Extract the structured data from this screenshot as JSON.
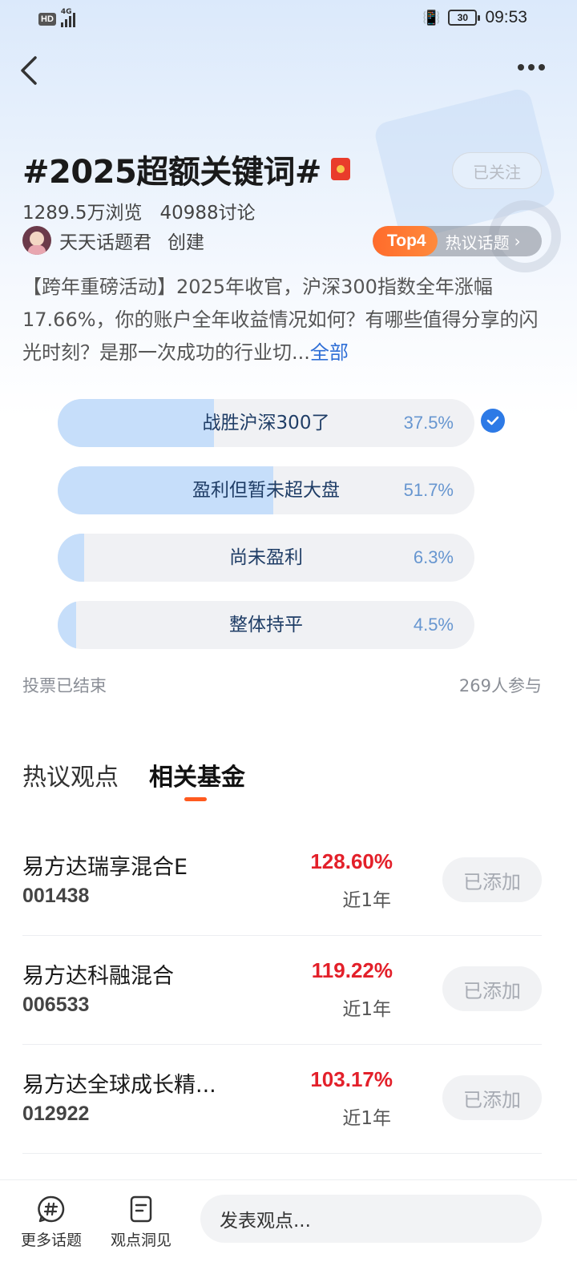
{
  "status_bar": {
    "hd": "HD",
    "network": "4G",
    "battery": "30",
    "time": "09:53"
  },
  "topic": {
    "title": "#2025超额关键词#",
    "follow_label": "已关注",
    "views": "1289.5万浏览",
    "discussions": "40988讨论",
    "creator_name": "天天话题君",
    "creator_action": "创建",
    "rank_tag": "Top4",
    "rank_label": "热议话题",
    "description": "【跨年重磅活动】2025年收官，沪深300指数全年涨幅17.66%，你的账户全年收益情况如何？有哪些值得分享的闪光时刻？是那一次成功的行业切...",
    "more_label": "全部"
  },
  "poll": {
    "options": [
      {
        "label": "战胜沪深300了",
        "percent": "37.5%",
        "fill": 0.375,
        "selected": true
      },
      {
        "label": "盈利但暂未超大盘",
        "percent": "51.7%",
        "fill": 0.517,
        "selected": false
      },
      {
        "label": "尚未盈利",
        "percent": "6.3%",
        "fill": 0.063,
        "selected": false
      },
      {
        "label": "整体持平",
        "percent": "4.5%",
        "fill": 0.045,
        "selected": false
      }
    ],
    "status": "投票已结束",
    "participants": "269人参与"
  },
  "tabs": [
    {
      "label": "热议观点",
      "active": false
    },
    {
      "label": "相关基金",
      "active": true
    }
  ],
  "funds": [
    {
      "name": "易方达瑞享混合E",
      "code": "001438",
      "return": "128.60%",
      "period": "近1年",
      "button": "已添加"
    },
    {
      "name": "易方达科融混合",
      "code": "006533",
      "return": "119.22%",
      "period": "近1年",
      "button": "已添加"
    },
    {
      "name": "易方达全球成长精...",
      "code": "012922",
      "return": "103.17%",
      "period": "近1年",
      "button": "已添加"
    }
  ],
  "bottom_bar": {
    "more_topics": "更多话题",
    "insights": "观点洞见",
    "comment_placeholder": "发表观点..."
  },
  "colors": {
    "accent_orange": "#ff5a1f",
    "return_red": "#e3202a",
    "poll_fill": "#c6defa",
    "link_blue": "#2f6fd6"
  },
  "icons": [
    "back-arrow-icon",
    "more-dots-icon",
    "red-packet-icon",
    "check-icon",
    "hashtag-icon",
    "document-icon",
    "chevron-right-icon"
  ]
}
